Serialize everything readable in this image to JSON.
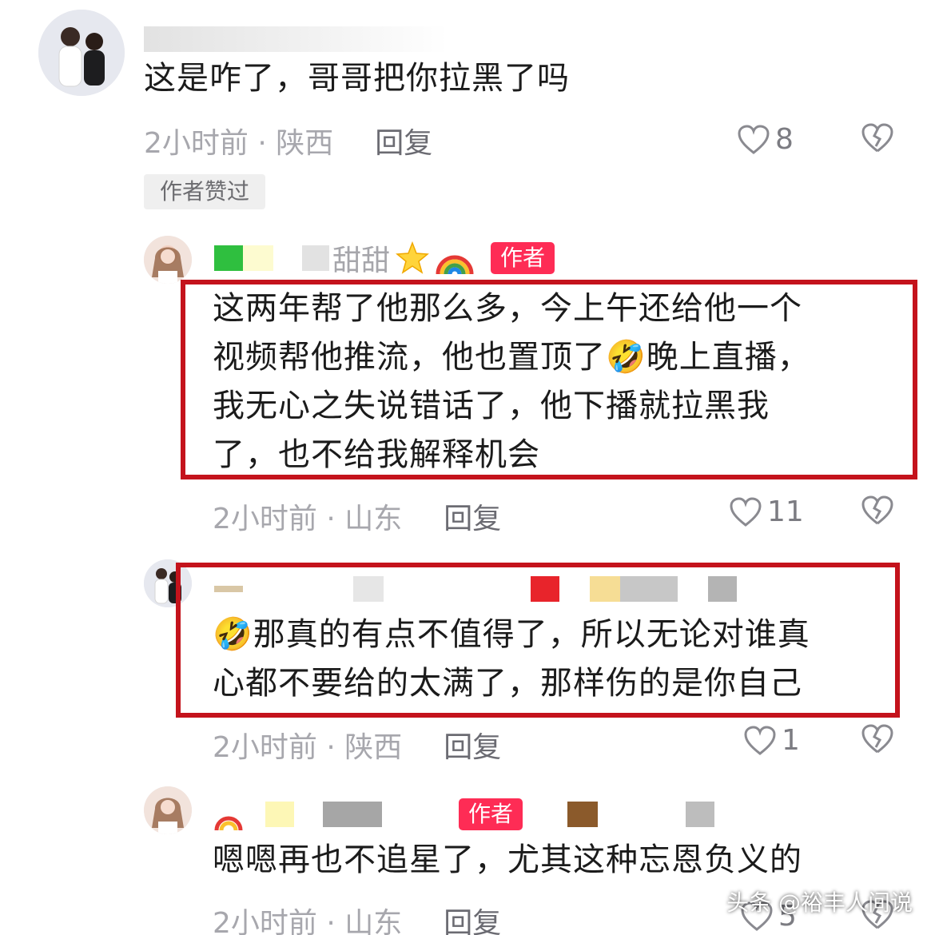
{
  "comments": [
    {
      "text": "这是咋了，哥哥把你拉黑了吗",
      "time_location": "2小时前 · 陕西",
      "reply_label": "回复",
      "likes": "8",
      "badge": "作者赞过"
    },
    {
      "nickname": "甜甜",
      "author_tag": "作者",
      "text_lines": [
        "这两年帮了他那么多，今上午还给他一个",
        "视频帮他推流，他也置顶了🤣晚上直播，",
        "我无心之失说错话了，他下播就拉黑我",
        "了，也不给我解释机会"
      ],
      "time_location": "2小时前 · 山东",
      "reply_label": "回复",
      "likes": "11"
    },
    {
      "text_lines": [
        "🤣那真的有点不值得了，所以无论对谁真",
        "心都不要给的太满了，那样伤的是你自己"
      ],
      "time_location": "2小时前 · 陕西",
      "reply_label": "回复",
      "likes": "1"
    },
    {
      "author_tag": "作者",
      "text": "嗯嗯再也不追星了，尤其这种忘恩负义的",
      "time_location": "2小时前 · 山东",
      "reply_label": "回复",
      "likes": "5"
    }
  ],
  "watermark": "头条 @裕丰人间说",
  "colors": {
    "highlight_box": "#c4131c",
    "author_tag_bg": "#fe2c55",
    "meta_gray": "#a7a7ad"
  },
  "icons": [
    "heart-outline-icon",
    "broken-heart-icon",
    "star-emoji-icon",
    "rainbow-emoji-icon"
  ]
}
